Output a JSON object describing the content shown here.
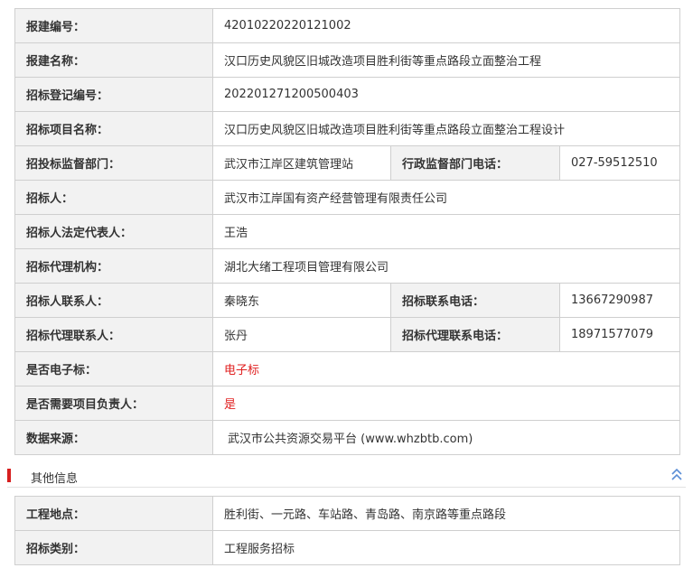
{
  "main": {
    "rows": [
      {
        "label": "报建编号：",
        "value": "42010220220121002"
      },
      {
        "label": "报建名称：",
        "value": "汉口历史风貌区旧城改造项目胜利街等重点路段立面整治工程"
      },
      {
        "label": "招标登记编号：",
        "value": "202201271200500403"
      },
      {
        "label": "招标项目名称：",
        "value": "汉口历史风貌区旧城改造项目胜利街等重点路段立面整治工程设计"
      },
      {
        "label": "招投标监督部门：",
        "value": "武汉市江岸区建筑管理站",
        "label2": "行政监督部门电话：",
        "value2": "027-59512510"
      },
      {
        "label": "招标人：",
        "value": "武汉市江岸国有资产经营管理有限责任公司"
      },
      {
        "label": "招标人法定代表人：",
        "value": "王浩"
      },
      {
        "label": "招标代理机构：",
        "value": "湖北大绪工程项目管理有限公司"
      },
      {
        "label": "招标人联系人：",
        "value": "秦晓东",
        "label2": "招标联系电话：",
        "value2": "13667290987"
      },
      {
        "label": "招标代理联系人：",
        "value": "张丹",
        "label2": "招标代理联系电话：",
        "value2": "18971577079"
      },
      {
        "label": "是否电子标：",
        "value": "电子标"
      },
      {
        "label": "是否需要项目负责人：",
        "value": "是"
      },
      {
        "label": "数据来源：",
        "value": "武汉市公共资源交易平台 (www.whzbtb.com)"
      }
    ]
  },
  "section": {
    "title": "其他信息",
    "toggle_icon": "double-chevron-up-icon"
  },
  "other": {
    "rows": [
      {
        "label": "工程地点：",
        "value": "胜利街、一元路、车站路、青岛路、南京路等重点路段"
      },
      {
        "label": "招标类别：",
        "value": "工程服务招标"
      }
    ]
  },
  "colors": {
    "accent": "#d71f1f",
    "label_bg": "#f2f2f2",
    "border": "#cfcfcf",
    "highlight": "#e02020",
    "icon": "#5b8ed6"
  }
}
